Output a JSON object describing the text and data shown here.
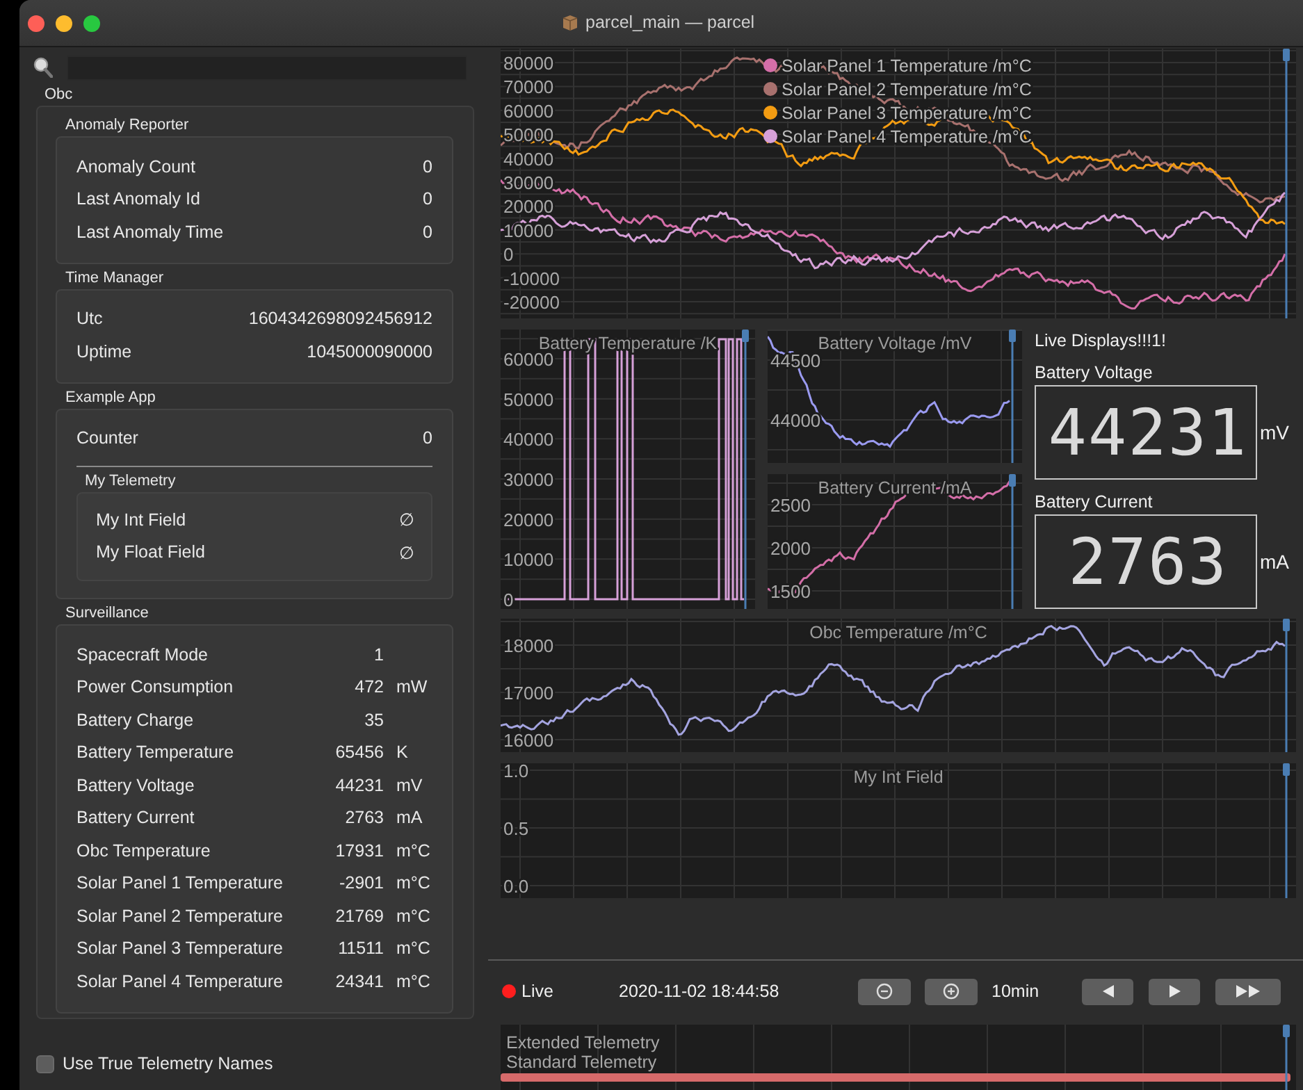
{
  "window": {
    "title": "parcel_main — parcel"
  },
  "tree": {
    "title": "Obc",
    "groups": [
      {
        "title": "Anomaly Reporter",
        "rows": [
          {
            "name": "Anomaly Count",
            "value": "0"
          },
          {
            "name": "Last Anomaly Id",
            "value": "0"
          },
          {
            "name": "Last Anomaly Time",
            "value": "0"
          }
        ]
      },
      {
        "title": "Time Manager",
        "rows": [
          {
            "name": "Utc",
            "value": "1604342698092456912"
          },
          {
            "name": "Uptime",
            "value": "1045000090000"
          }
        ]
      },
      {
        "title": "Example App",
        "rows": [
          {
            "name": "Counter",
            "value": "0"
          }
        ],
        "subgroups": [
          {
            "title": "My Telemetry",
            "rows": [
              {
                "name": "My Int Field",
                "value": "∅"
              },
              {
                "name": "My Float Field",
                "value": "∅"
              }
            ]
          }
        ]
      },
      {
        "title": "Surveillance",
        "rows": [
          {
            "name": "Spacecraft Mode",
            "value": "1"
          },
          {
            "name": "Power Consumption",
            "value": "472",
            "unit": "mW"
          },
          {
            "name": "Battery Charge",
            "value": "35"
          },
          {
            "name": "Battery Temperature",
            "value": "65456",
            "unit": "K"
          },
          {
            "name": "Battery Voltage",
            "value": "44231",
            "unit": "mV"
          },
          {
            "name": "Battery Current",
            "value": "2763",
            "unit": "mA"
          },
          {
            "name": "Obc Temperature",
            "value": "17931",
            "unit": "m°C"
          },
          {
            "name": "Solar Panel 1 Temperature",
            "value": "-2901",
            "unit": "m°C"
          },
          {
            "name": "Solar Panel 2 Temperature",
            "value": "21769",
            "unit": "m°C"
          },
          {
            "name": "Solar Panel 3 Temperature",
            "value": "11511",
            "unit": "m°C"
          },
          {
            "name": "Solar Panel 4 Temperature",
            "value": "24341",
            "unit": "m°C"
          }
        ]
      }
    ]
  },
  "true_names_option": {
    "label": "Use True Telemetry Names",
    "checked": false
  },
  "charts": [
    {
      "y_ticks": [
        "80000",
        "70000",
        "60000",
        "50000",
        "40000",
        "30000",
        "20000",
        "10000",
        "0",
        "-10000",
        "-20000"
      ],
      "series": [
        {
          "name": "Solar Panel 1 Temperature /m°C",
          "color": "#d46ea8"
        },
        {
          "name": "Solar Panel 2 Temperature /m°C",
          "color": "#a8716e"
        },
        {
          "name": "Solar Panel 3 Temperature /m°C",
          "color": "#f39c12"
        },
        {
          "name": "Solar Panel 4 Temperature /m°C",
          "color": "#d6a0d8"
        }
      ]
    },
    {
      "title": "Battery Temperature /K",
      "y_ticks": [
        "60000",
        "50000",
        "40000",
        "30000",
        "20000",
        "10000",
        "0"
      ],
      "series": [
        {
          "color": "#d6a0d8"
        }
      ]
    },
    {
      "title": "Battery Voltage /mV",
      "y_ticks": [
        "44500",
        "44000"
      ],
      "series": [
        {
          "color": "#9a9af0"
        }
      ]
    },
    {
      "title": "Battery Current /mA",
      "y_ticks": [
        "2500",
        "2000",
        "1500"
      ],
      "series": [
        {
          "color": "#d46ea8"
        }
      ]
    },
    {
      "title": "Obc Temperature /m°C",
      "y_ticks": [
        "18000",
        "17000",
        "16000"
      ],
      "series": [
        {
          "color": "#a4a4e0"
        }
      ]
    },
    {
      "title": "My Int Field",
      "y_ticks": [
        "1.0",
        "0.5",
        "0.0"
      ]
    }
  ],
  "live_displays": {
    "title": "Live Displays!!!1!",
    "displays": [
      {
        "label": "Battery Voltage",
        "value": "44231",
        "unit": "mV"
      },
      {
        "label": "Battery Current",
        "value": "2763",
        "unit": "mA"
      }
    ]
  },
  "playback": {
    "live": {
      "label": "Live",
      "on": true
    },
    "timestamp": "2020-11-02 18:44:58",
    "window": "10min"
  },
  "timeline": {
    "tracks": [
      "Extended Telemetry",
      "Standard Telemetry"
    ]
  }
}
